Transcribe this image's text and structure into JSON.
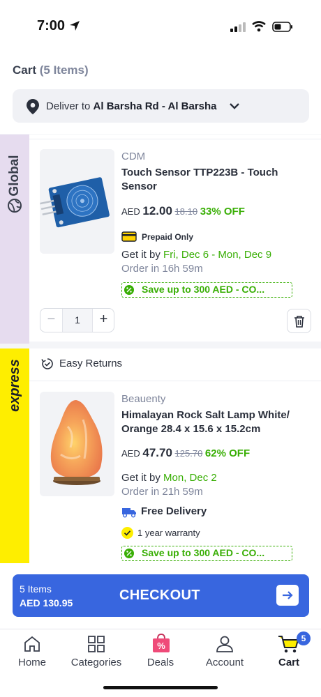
{
  "status_bar": {
    "time": "7:00"
  },
  "header": {
    "cart_label": "Cart",
    "cart_count": "(5 Items)",
    "deliver_prefix": "Deliver to",
    "deliver_location": "Al Barsha Rd - Al Barsha"
  },
  "sections": {
    "global_label": "Global",
    "express_label": "express"
  },
  "items": [
    {
      "brand": "CDM",
      "title_line1": "Touch Sensor TTP223B - Touch",
      "title_line2": "Sensor",
      "currency": "AED",
      "price": "12.00",
      "old_price": "18.10",
      "discount": "33% OFF",
      "badge": "Prepaid Only",
      "get_it_prefix": "Get it by",
      "delivery_date": "Fri, Dec 6 - Mon, Dec 9",
      "order_in": "Order in 16h 59m",
      "save_text": "Save up to 300 AED  - CO...",
      "quantity": "1"
    },
    {
      "returns_label": "Easy Returns",
      "brand": "Beauenty",
      "title_line1": "Himalayan Rock Salt Lamp White/",
      "title_line2": "Orange 28.4 x 15.6 x 15.2cm",
      "currency": "AED",
      "price": "47.70",
      "old_price": "125.70",
      "discount": "62% OFF",
      "get_it_prefix": "Get it by",
      "delivery_date": "Mon, Dec 2",
      "order_in": "Order in 21h 59m",
      "free_delivery": "Free Delivery",
      "warranty": "1 year warranty",
      "save_text": "Save up to 300 AED  - CO..."
    }
  ],
  "checkout": {
    "items": "5 Items",
    "total": "AED 130.95",
    "label": "CHECKOUT"
  },
  "tabs": [
    {
      "label": "Home",
      "icon": "home-icon"
    },
    {
      "label": "Categories",
      "icon": "grid-icon"
    },
    {
      "label": "Deals",
      "icon": "deals-icon"
    },
    {
      "label": "Account",
      "icon": "user-icon"
    },
    {
      "label": "Cart",
      "icon": "cart-icon",
      "badge": "5"
    }
  ],
  "colors": {
    "accent_blue": "#3866df",
    "discount_green": "#38ae04",
    "express_yellow": "#feee00",
    "global_purple": "#e6dcef"
  }
}
